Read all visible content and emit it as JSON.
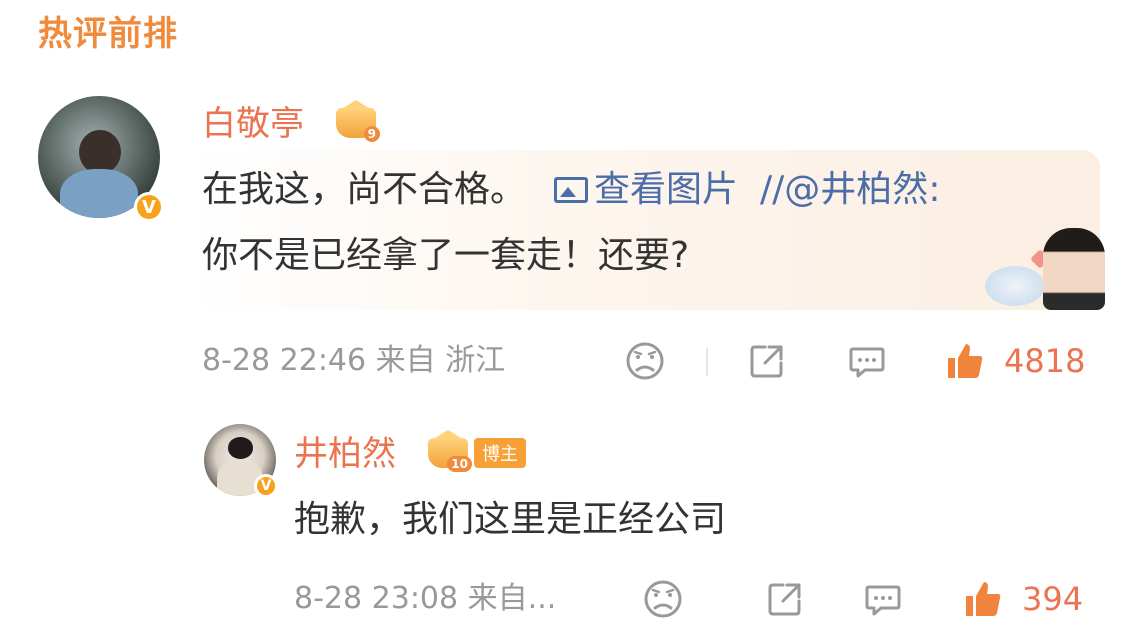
{
  "section": {
    "title": "热评前排"
  },
  "colors": {
    "accent": "#eb7350",
    "title": "#f08a3c",
    "link": "#4c6ea8",
    "meta": "#999999",
    "text": "#333333"
  },
  "comment": {
    "username": "白敬亭",
    "level": "9",
    "badge": "V",
    "text_line1_main": "在我这，尚不合格。",
    "pic_link": "查看图片",
    "repost_prefix": "//",
    "mention": "@井柏然",
    "colon": ":",
    "text_line2": "你不是已经拿了一套走！还要?",
    "date": "8-28",
    "time": "22:46",
    "from_label": "来自",
    "location": "浙江",
    "likes": "4818",
    "icons": [
      "dislike-icon",
      "share-icon",
      "comment-icon",
      "like-icon"
    ]
  },
  "reply": {
    "username": "井柏然",
    "level": "10",
    "badge": "V",
    "blogger_tag": "博主",
    "text": "抱歉，我们这里是正经公司",
    "date": "8-28",
    "time": "23:08",
    "from_label": "来自...",
    "likes": "394",
    "icons": [
      "dislike-icon",
      "share-icon",
      "comment-icon",
      "like-icon"
    ]
  }
}
